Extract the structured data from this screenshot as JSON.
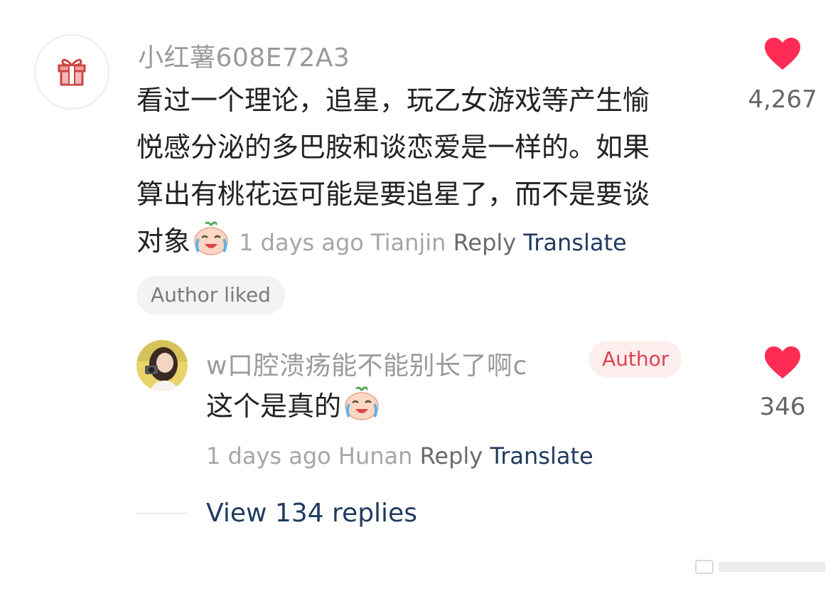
{
  "comment": {
    "username": "小红薯608E72A3",
    "text_lines": [
      "看过一个理论，追星，玩乙女游戏等产生愉",
      "悦感分泌的多巴胺和谈恋爱是一样的。如果",
      "算出有桃花运可能是要追星了，而不是要谈",
      "对象"
    ],
    "avatar_icon": "gift-icon",
    "emoji": "crying-laughing-emoji",
    "time": "1 days ago",
    "location": "Tianjin",
    "reply_label": "Reply",
    "translate_label": "Translate",
    "like_count": "4,267",
    "author_liked_label": "Author liked"
  },
  "reply": {
    "username": "w口腔溃疡能不能别长了啊c",
    "author_badge": "Author",
    "text": "这个是真的",
    "emoji": "crying-laughing-emoji",
    "time": "1 days ago",
    "location": "Hunan",
    "reply_label": "Reply",
    "translate_label": "Translate",
    "like_count": "346"
  },
  "view_replies_label": "View 134 replies",
  "colors": {
    "like_red": "#fe2c55",
    "translate_blue": "#1f3a5f",
    "author_badge_text": "#e0414f",
    "author_badge_bg": "#fdeeee"
  }
}
